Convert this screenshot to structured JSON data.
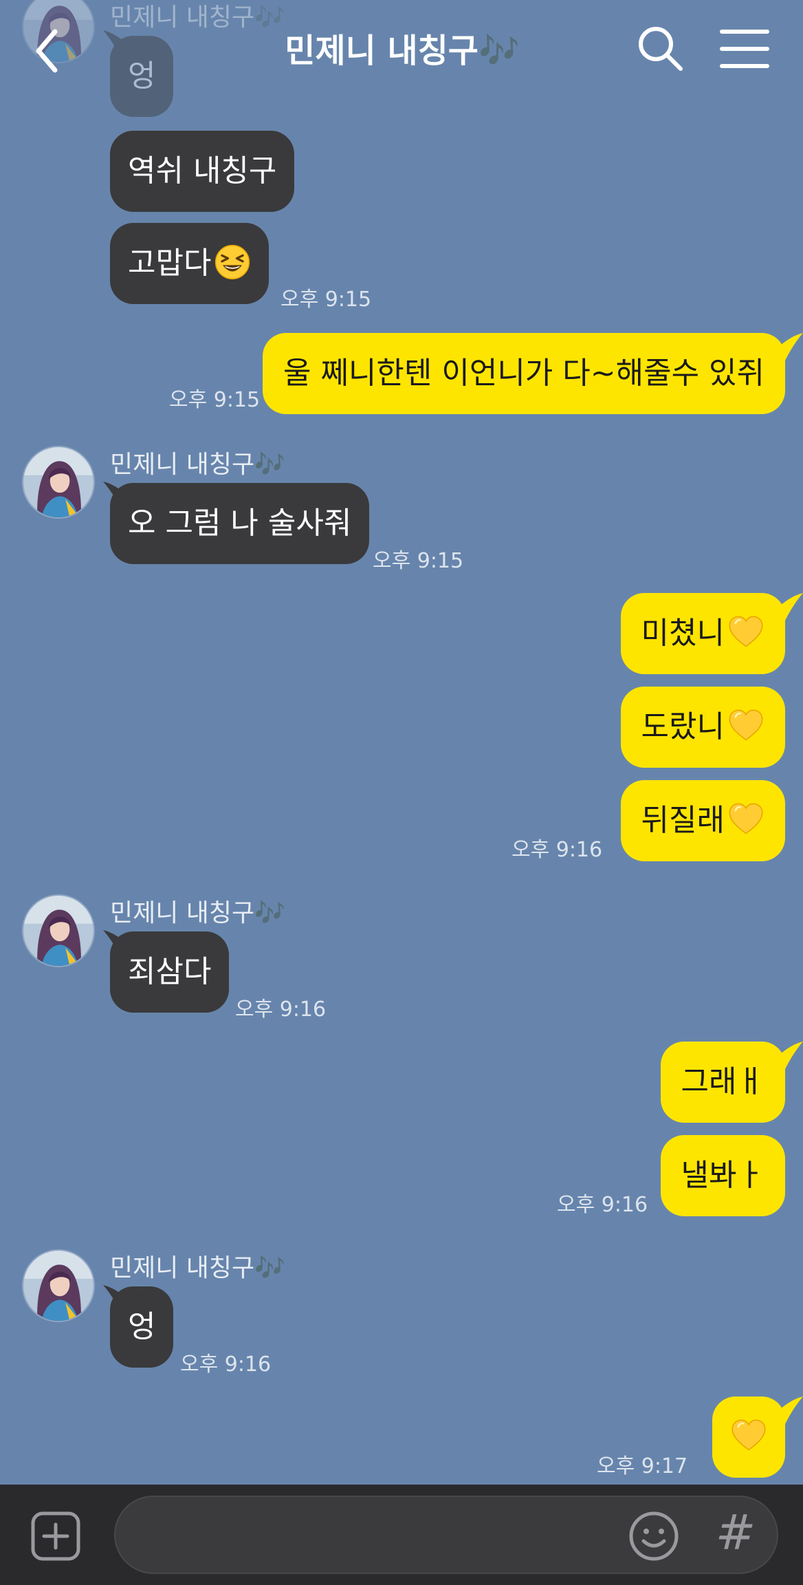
{
  "header": {
    "title": "민제니 내칭구🎶"
  },
  "messages": [
    {
      "id": "m0",
      "sender": "민제니 내칭구🎶",
      "text": "엉",
      "faded": true
    },
    {
      "id": "m1",
      "text": "역쉬 내칭구"
    },
    {
      "id": "m2",
      "text": "고맙다",
      "emoji": "grinning-squint-emoji",
      "time": "오후 9:15"
    },
    {
      "id": "m3",
      "text": "울 쩨니한텐 이언니가 다~해줄수 있쥐",
      "time": "오후 9:15"
    },
    {
      "id": "m4",
      "sender": "민제니 내칭구🎶",
      "text": "오 그럼 나 술사줘",
      "time": "오후 9:15"
    },
    {
      "id": "m5",
      "text": "미쳤니",
      "emoji": "yellow-heart-emoji"
    },
    {
      "id": "m6",
      "text": "도랐니",
      "emoji": "yellow-heart-emoji"
    },
    {
      "id": "m7",
      "text": "뒤질래",
      "emoji": "yellow-heart-emoji",
      "time": "오후 9:16"
    },
    {
      "id": "m8",
      "sender": "민제니 내칭구🎶",
      "text": "죄삼다",
      "time": "오후 9:16"
    },
    {
      "id": "m9",
      "text": "그래ㅐ"
    },
    {
      "id": "m10",
      "text": "낼봐ㅏ",
      "time": "오후 9:16"
    },
    {
      "id": "m11",
      "sender": "민제니 내칭구🎶",
      "text": "엉",
      "time": "오후 9:16"
    },
    {
      "id": "m12",
      "emoji": "yellow-heart-emoji",
      "time": "오후 9:17"
    }
  ],
  "input": {
    "placeholder": "",
    "value": ""
  },
  "input_bar": {
    "hash_label": "#"
  },
  "icons": {
    "back": "chevron-left-icon",
    "search": "search-icon",
    "menu": "hamburger-menu-icon",
    "plus": "plus-icon",
    "emoticon": "smiley-icon"
  },
  "colors": {
    "background": "#6785ac",
    "incoming_bubble": "#3a3a3c",
    "outgoing_bubble": "#fee500",
    "input_bar": "#2a2a2c"
  }
}
